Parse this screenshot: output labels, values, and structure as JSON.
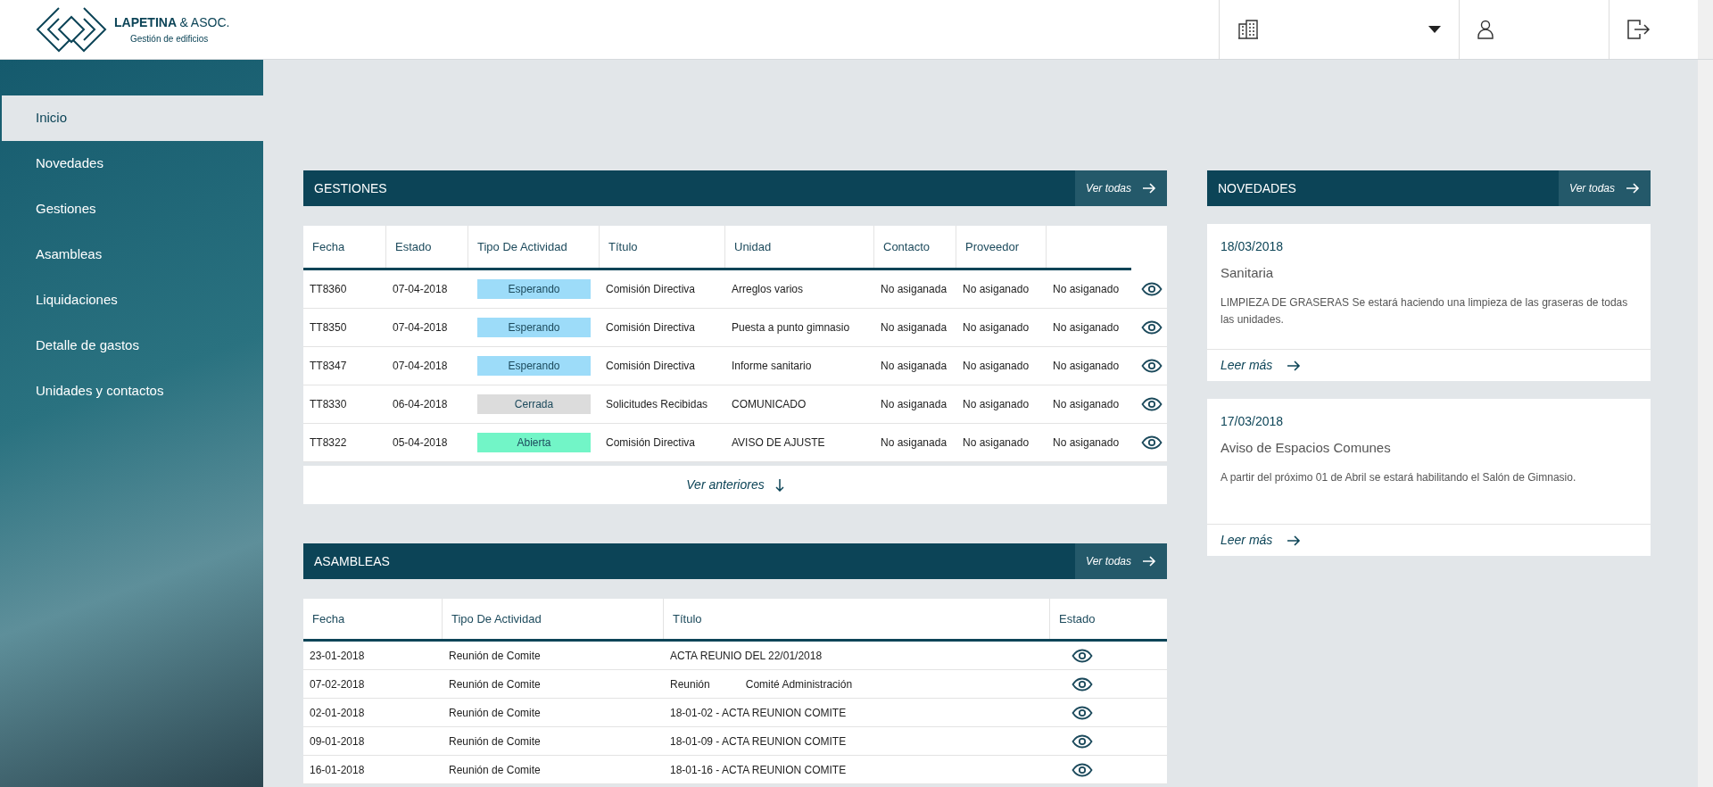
{
  "header": {
    "brand": {
      "name": "LAPETINA",
      "amp": "& ASOC.",
      "tagline": "Gestión de edificios"
    }
  },
  "sidebar": {
    "items": [
      {
        "label": "Inicio",
        "selected": true
      },
      {
        "label": "Novedades",
        "selected": false
      },
      {
        "label": "Gestiones",
        "selected": false
      },
      {
        "label": "Asambleas",
        "selected": false
      },
      {
        "label": "Liquidaciones",
        "selected": false
      },
      {
        "label": "Detalle de gastos",
        "selected": false
      },
      {
        "label": "Unidades y contactos",
        "selected": false
      }
    ]
  },
  "gestiones": {
    "title": "GESTIONES",
    "link": "Ver todas",
    "columns": [
      "Fecha",
      "Estado",
      "Tipo De Actividad",
      "Título",
      "Unidad",
      "Contacto",
      "Proveedor"
    ],
    "rows": [
      {
        "cells": [
          "TT8360",
          "07-04-2018",
          "Esperando",
          "Comisión Directiva",
          "Arreglos varios",
          "No asiganada",
          "No asiganado",
          "No asiganado"
        ],
        "color": "#9ddcf9"
      },
      {
        "cells": [
          "TT8350",
          "07-04-2018",
          "Esperando",
          "Comisión Directiva",
          "Puesta a punto gimnasio",
          "No asiganada",
          "No asiganado",
          "No asiganado"
        ],
        "color": "#9ddcf9"
      },
      {
        "cells": [
          "TT8347",
          "07-04-2018",
          "Esperando",
          "Comisión Directiva",
          "Informe sanitario",
          "No asiganada",
          "No asiganado",
          "No asiganado"
        ],
        "color": "#9ddcf9"
      },
      {
        "cells": [
          "TT8330",
          "06-04-2018",
          "Cerrada",
          "Solicitudes Recibidas",
          "COMUNICADO",
          "No asiganada",
          "No asiganado",
          "No asiganado"
        ],
        "color": "#dcdcdc"
      },
      {
        "cells": [
          "TT8322",
          "05-04-2018",
          "Abierta",
          "Comisión Directiva",
          "AVISO DE AJUSTE",
          "No asiganada",
          "No asiganado",
          "No asiganado"
        ],
        "color": "#72f5c7"
      }
    ],
    "more": "Ver anteriores"
  },
  "asambleas": {
    "title": "ASAMBLEAS",
    "link": "Ver todas",
    "columns": [
      "Fecha",
      "Tipo De Actividad",
      "Título",
      "Estado"
    ],
    "rows": [
      {
        "cells": [
          "23-01-2018",
          "Reunión de Comite",
          "ACTA REUNIO DEL 22/01/2018"
        ]
      },
      {
        "cells": [
          "07-02-2018",
          "Reunión de Comite",
          "Reunión            Comité Administración"
        ]
      },
      {
        "cells": [
          "02-01-2018",
          "Reunión de Comite",
          "18-01-02 - ACTA REUNION COMITE"
        ]
      },
      {
        "cells": [
          "09-01-2018",
          "Reunión de Comite",
          "18-01-09 - ACTA REUNION COMITE"
        ]
      },
      {
        "cells": [
          "16-01-2018",
          "Reunión de Comite",
          "18-01-16 - ACTA REUNION COMITE"
        ]
      }
    ]
  },
  "novedades": {
    "title": "NOVEDADES",
    "link": "Ver todas",
    "items": [
      {
        "date": "18/03/2018",
        "title": "Sanitaria",
        "body": "LIMPIEZA DE GRASERAS Se estará haciendo una limpieza de las graseras de todas las unidades.",
        "link": "Leer más"
      },
      {
        "date": "17/03/2018",
        "title": "Aviso de Espacios Comunes",
        "body": "A partir del próximo 01 de Abril se estará habilitando el Salón de Gimnasio.",
        "link": "Leer más"
      }
    ]
  }
}
